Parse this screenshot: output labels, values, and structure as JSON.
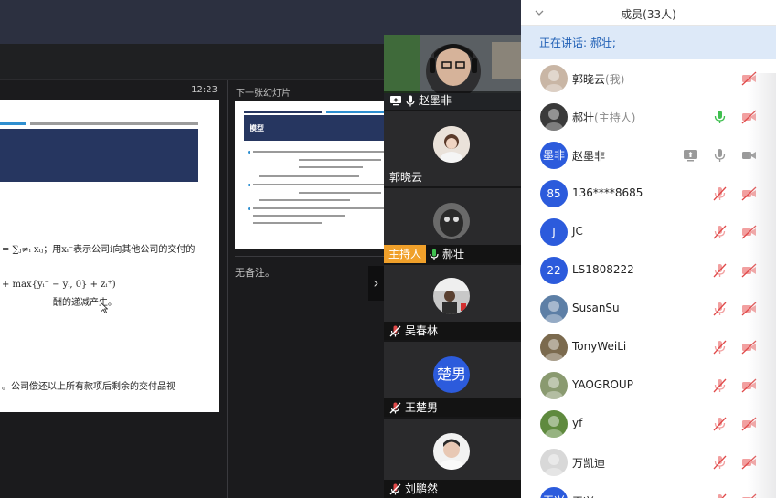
{
  "presenter": {
    "timer": "12:23",
    "slide_lines": [
      "= ∑ⱼ≠ᵢ xᵢⱼ；用xᵢ⁻表示公司i向其他公司的交付的",
      "+ max{yᵢ⁻ − yᵢ, 0} + zᵢ⁺)",
      "酬的递减产生。",
      "。公司偿还以上所有款项后剩余的交付品视"
    ]
  },
  "next_slide": {
    "label": "下一张幻灯片",
    "heading": "模型",
    "notes": "无备注。"
  },
  "videos": [
    {
      "name": "赵墨非",
      "share": true,
      "mic": "on"
    },
    {
      "name": "郭晓云",
      "mic": "none"
    },
    {
      "name": "郝壮",
      "badge": "主持人",
      "mic": "on"
    },
    {
      "name": "吴春林",
      "mic": "muted"
    },
    {
      "name": "王楚男",
      "avatar_text": "楚男",
      "mic": "muted"
    },
    {
      "name": "刘鹏然",
      "mic": "muted"
    }
  ],
  "panel": {
    "title": "成员(33人)",
    "speaking": "正在讲话: 郝壮;",
    "members": [
      {
        "name": "郭晓云",
        "role": "(我)",
        "avatar": "photo",
        "color": "#c9b6a5",
        "share": false,
        "mic": "none",
        "cam": "off"
      },
      {
        "name": "郝壮",
        "role": "(主持人)",
        "avatar": "photo",
        "color": "#3a3a3a",
        "share": false,
        "mic": "on",
        "cam": "off"
      },
      {
        "name": "赵墨非",
        "role": "",
        "avatar": "墨非",
        "color": "#2c5bdc",
        "share": true,
        "mic": "on-gray",
        "cam": "on"
      },
      {
        "name": "136****8685",
        "role": "",
        "avatar": "85",
        "color": "#2c5bdc",
        "share": false,
        "mic": "muted",
        "cam": "off"
      },
      {
        "name": "JC",
        "role": "",
        "avatar": "J",
        "color": "#2c5bdc",
        "share": false,
        "mic": "muted",
        "cam": "off"
      },
      {
        "name": "LS1808222",
        "role": "",
        "avatar": "22",
        "color": "#2c5bdc",
        "share": false,
        "mic": "muted",
        "cam": "off"
      },
      {
        "name": "SusanSu",
        "role": "",
        "avatar": "photo",
        "color": "#5d7fa6",
        "share": false,
        "mic": "muted",
        "cam": "off"
      },
      {
        "name": "TonyWeiLi",
        "role": "",
        "avatar": "photo",
        "color": "#7b6a4e",
        "share": false,
        "mic": "muted",
        "cam": "off"
      },
      {
        "name": "YAOGROUP",
        "role": "",
        "avatar": "photo",
        "color": "#8a9a70",
        "share": false,
        "mic": "muted",
        "cam": "off"
      },
      {
        "name": "yf",
        "role": "",
        "avatar": "photo",
        "color": "#5f8a3e",
        "share": false,
        "mic": "muted",
        "cam": "off"
      },
      {
        "name": "万凯迪",
        "role": "",
        "avatar": "photo",
        "color": "#d8d8d8",
        "share": false,
        "mic": "muted",
        "cam": "off"
      },
      {
        "name": "王兴",
        "role": "",
        "avatar": "王兴",
        "color": "#2c5bdc",
        "share": false,
        "mic": "muted",
        "cam": "off"
      }
    ]
  },
  "colors": {
    "accent": "#2c5bdc",
    "host_badge": "#f0a02a",
    "mute_red": "#e04a4a",
    "mic_green": "#3fbf4f"
  }
}
